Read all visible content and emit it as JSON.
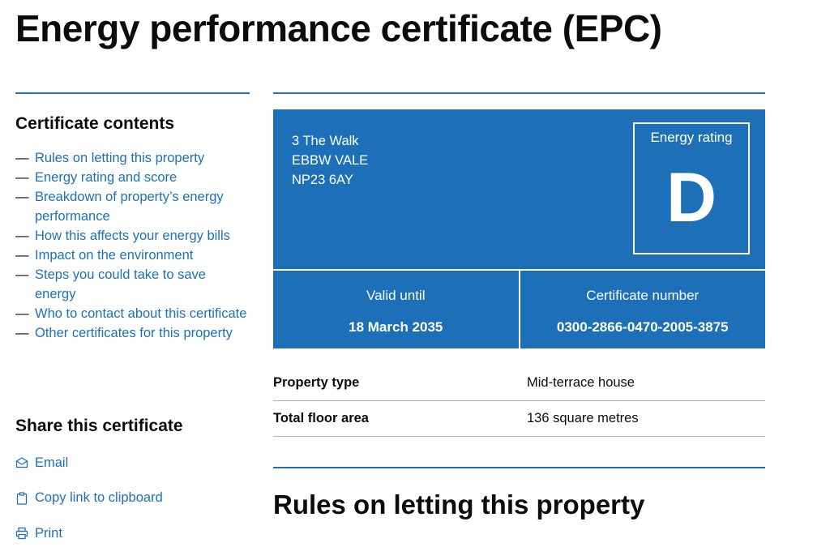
{
  "page": {
    "title": "Energy performance certificate (EPC)"
  },
  "sidebar": {
    "contents_title": "Certificate contents",
    "contents": [
      "Rules on letting this property",
      "Energy rating and score",
      "Breakdown of property’s energy performance",
      "How this affects your energy bills",
      "Impact on the environment",
      "Steps you could take to save energy",
      "Who to contact about this certificate",
      "Other certificates for this property"
    ],
    "share_title": "Share this certificate",
    "share": [
      {
        "label": "Email",
        "icon": "envelope-icon"
      },
      {
        "label": "Copy link to clipboard",
        "icon": "clipboard-icon"
      },
      {
        "label": "Print",
        "icon": "printer-icon"
      }
    ]
  },
  "certificate": {
    "address": [
      "3 The Walk",
      "EBBW VALE",
      "NP23 6AY"
    ],
    "rating_label": "Energy rating",
    "rating": "D",
    "valid_until_label": "Valid until",
    "valid_until": "18 March 2035",
    "number_label": "Certificate number",
    "number": "0300-2866-0470-2005-3875"
  },
  "summary": [
    {
      "key": "Property type",
      "value": "Mid-terrace house"
    },
    {
      "key": "Total floor area",
      "value": "136 square metres"
    }
  ],
  "section": {
    "title": "Rules on letting this property"
  },
  "colors": {
    "brand_blue": "#1d70b8",
    "text": "#0b0c0c",
    "divider": "#b1b4b6"
  }
}
